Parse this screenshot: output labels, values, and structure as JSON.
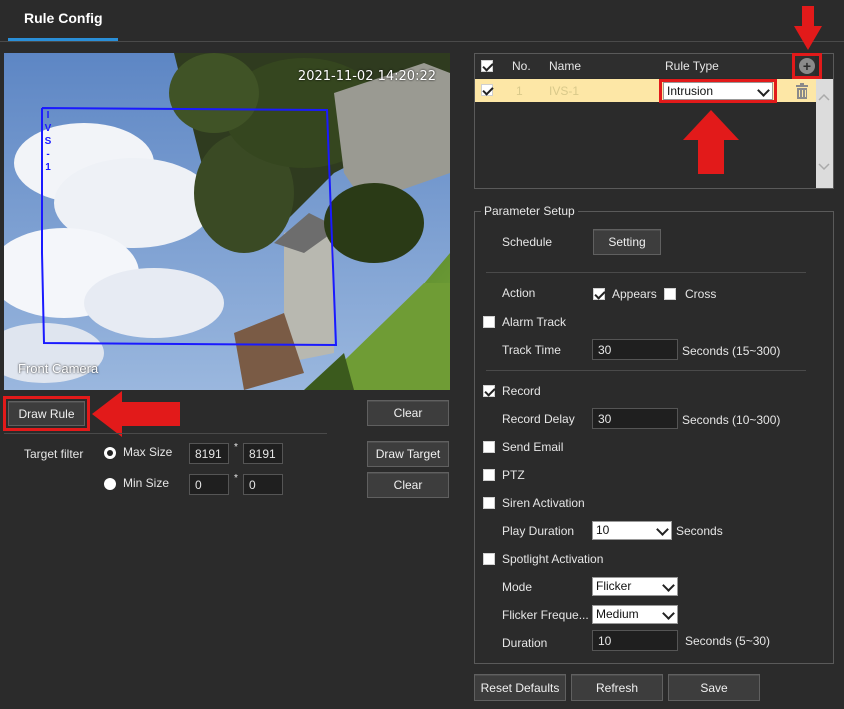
{
  "tab": {
    "label": "Rule Config"
  },
  "video": {
    "timestamp": "2021-11-02 14:20:22",
    "camera_name": "Front Camera",
    "rule_label": "IVS-1"
  },
  "left": {
    "draw_rule": "Draw Rule",
    "clear_top": "Clear",
    "target_filter_label": "Target filter",
    "max_size_label": "Max Size",
    "max_w": "8191",
    "max_h": "8191",
    "min_size_label": "Min Size",
    "min_w": "0",
    "min_h": "0",
    "size_sep": "*",
    "draw_target": "Draw Target",
    "clear_bottom": "Clear"
  },
  "rules_table": {
    "headers": {
      "no": "No.",
      "name": "Name",
      "rule_type": "Rule Type"
    },
    "rows": [
      {
        "no": "1",
        "name": "IVS-1",
        "rule_type": "Intrusion"
      }
    ]
  },
  "params": {
    "legend": "Parameter Setup",
    "schedule_label": "Schedule",
    "setting_button": "Setting",
    "action_label": "Action",
    "appears_label": "Appears",
    "cross_label": "Cross",
    "alarm_track_label": "Alarm Track",
    "track_time_label": "Track Time",
    "track_time_value": "30",
    "track_time_unit": "Seconds (15~300)",
    "record_label": "Record",
    "record_delay_label": "Record Delay",
    "record_delay_value": "30",
    "record_delay_unit": "Seconds (10~300)",
    "send_email_label": "Send Email",
    "ptz_label": "PTZ",
    "siren_label": "Siren Activation",
    "play_duration_label": "Play Duration",
    "play_duration_value": "10",
    "play_duration_unit": "Seconds",
    "spotlight_label": "Spotlight Activation",
    "mode_label": "Mode",
    "mode_value": "Flicker",
    "flicker_freq_label": "Flicker Freque...",
    "flicker_freq_value": "Medium",
    "duration_label": "Duration",
    "duration_value": "10",
    "duration_unit": "Seconds (5~30)"
  },
  "footer": {
    "reset": "Reset Defaults",
    "refresh": "Refresh",
    "save": "Save"
  },
  "colors": {
    "accent": "#2a8fd8",
    "highlight_red": "#e21a1a",
    "selected_row": "#fde7a6",
    "rule_line": "#1a1aff"
  }
}
